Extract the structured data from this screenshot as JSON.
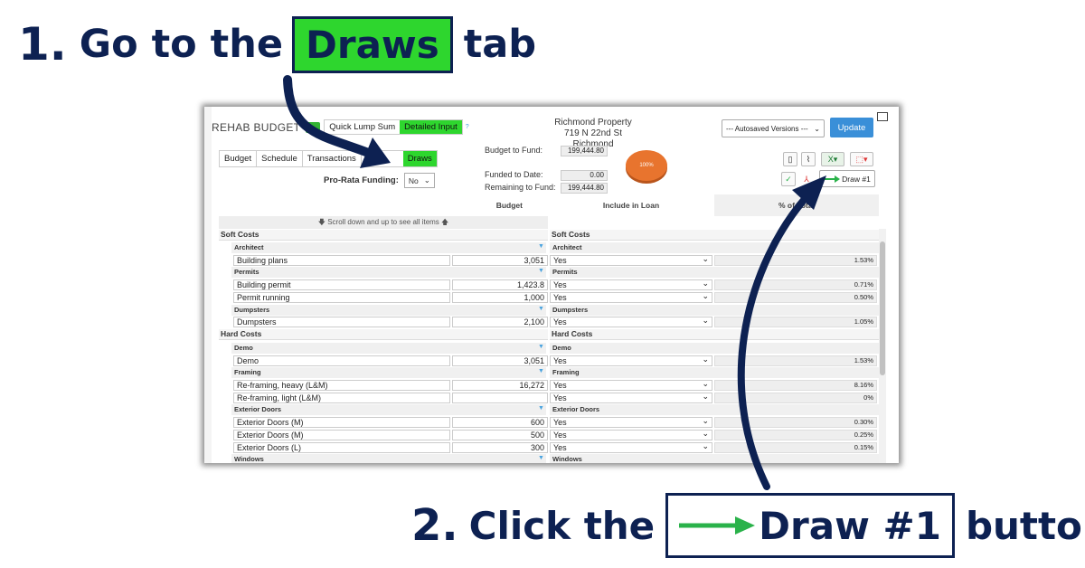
{
  "step1": {
    "number": "1.",
    "text": "Go to the",
    "highlight": "Draws",
    "suffix": "tab"
  },
  "step2": {
    "number": "2.",
    "text": "Click the",
    "button_label": "Draw #1",
    "suffix": "button"
  },
  "colors": {
    "accent_green": "#2ed62e",
    "navy": "#0d2152",
    "update_blue": "#3a8fd8",
    "pie_orange": "#e8742e",
    "arrow_green": "#2ab24a"
  },
  "app": {
    "title": "REHAB BUDGET",
    "quick_lump_sum": "Quick Lump Sum",
    "detailed_input": "Detailed Input",
    "property_name": "Richmond Property",
    "property_address": "719 N 22nd St Richmond",
    "autosave": "--- Autosaved Versions ---",
    "update": "Update",
    "tabs": [
      "Budget",
      "Schedule",
      "Transactions",
      "Draws"
    ],
    "pro_rata_label": "Pro-Rata Funding:",
    "pro_rata_value": "No",
    "budget_to_fund_label": "Budget to Fund:",
    "budget_to_fund": "199,444.80",
    "funded_to_date_label": "Funded to Date:",
    "funded_to_date": "0.00",
    "remaining_label": "Remaining to Fund:",
    "remaining": "199,444.80",
    "pie_label": "100%",
    "draw_button": "Draw #1",
    "col_budget": "Budget",
    "col_include": "Include in Loan",
    "col_pct": "% of Total",
    "scroll_note": "Scroll down and up to see all items",
    "soft_costs": "Soft Costs",
    "hard_costs": "Hard Costs",
    "rows": [
      {
        "kind": "sub",
        "name": "Architect"
      },
      {
        "kind": "item",
        "name": "Building plans",
        "budget": "3,051",
        "include": "Yes",
        "pct": "1.53%"
      },
      {
        "kind": "sub",
        "name": "Permits"
      },
      {
        "kind": "item",
        "name": "Building permit",
        "budget": "1,423.8",
        "include": "Yes",
        "pct": "0.71%"
      },
      {
        "kind": "item",
        "name": "Permit running",
        "budget": "1,000",
        "include": "Yes",
        "pct": "0.50%"
      },
      {
        "kind": "sub",
        "name": "Dumpsters"
      },
      {
        "kind": "item",
        "name": "Dumpsters",
        "budget": "2,100",
        "include": "Yes",
        "pct": "1.05%"
      },
      {
        "kind": "sect",
        "name": "Hard Costs"
      },
      {
        "kind": "sub",
        "name": "Demo"
      },
      {
        "kind": "item",
        "name": "Demo",
        "budget": "3,051",
        "include": "Yes",
        "pct": "1.53%"
      },
      {
        "kind": "sub",
        "name": "Framing"
      },
      {
        "kind": "item",
        "name": "Re-framing, heavy (L&M)",
        "budget": "16,272",
        "include": "Yes",
        "pct": "8.16%"
      },
      {
        "kind": "item",
        "name": "Re-framing, light (L&M)",
        "budget": "",
        "include": "Yes",
        "pct": "0%"
      },
      {
        "kind": "sub",
        "name": "Exterior Doors"
      },
      {
        "kind": "item",
        "name": "Exterior Doors (M)",
        "budget": "600",
        "include": "Yes",
        "pct": "0.30%"
      },
      {
        "kind": "item",
        "name": "Exterior Doors (M)",
        "budget": "500",
        "include": "Yes",
        "pct": "0.25%"
      },
      {
        "kind": "item",
        "name": "Exterior Doors (L)",
        "budget": "300",
        "include": "Yes",
        "pct": "0.15%"
      },
      {
        "kind": "sub",
        "name": "Windows"
      }
    ]
  }
}
